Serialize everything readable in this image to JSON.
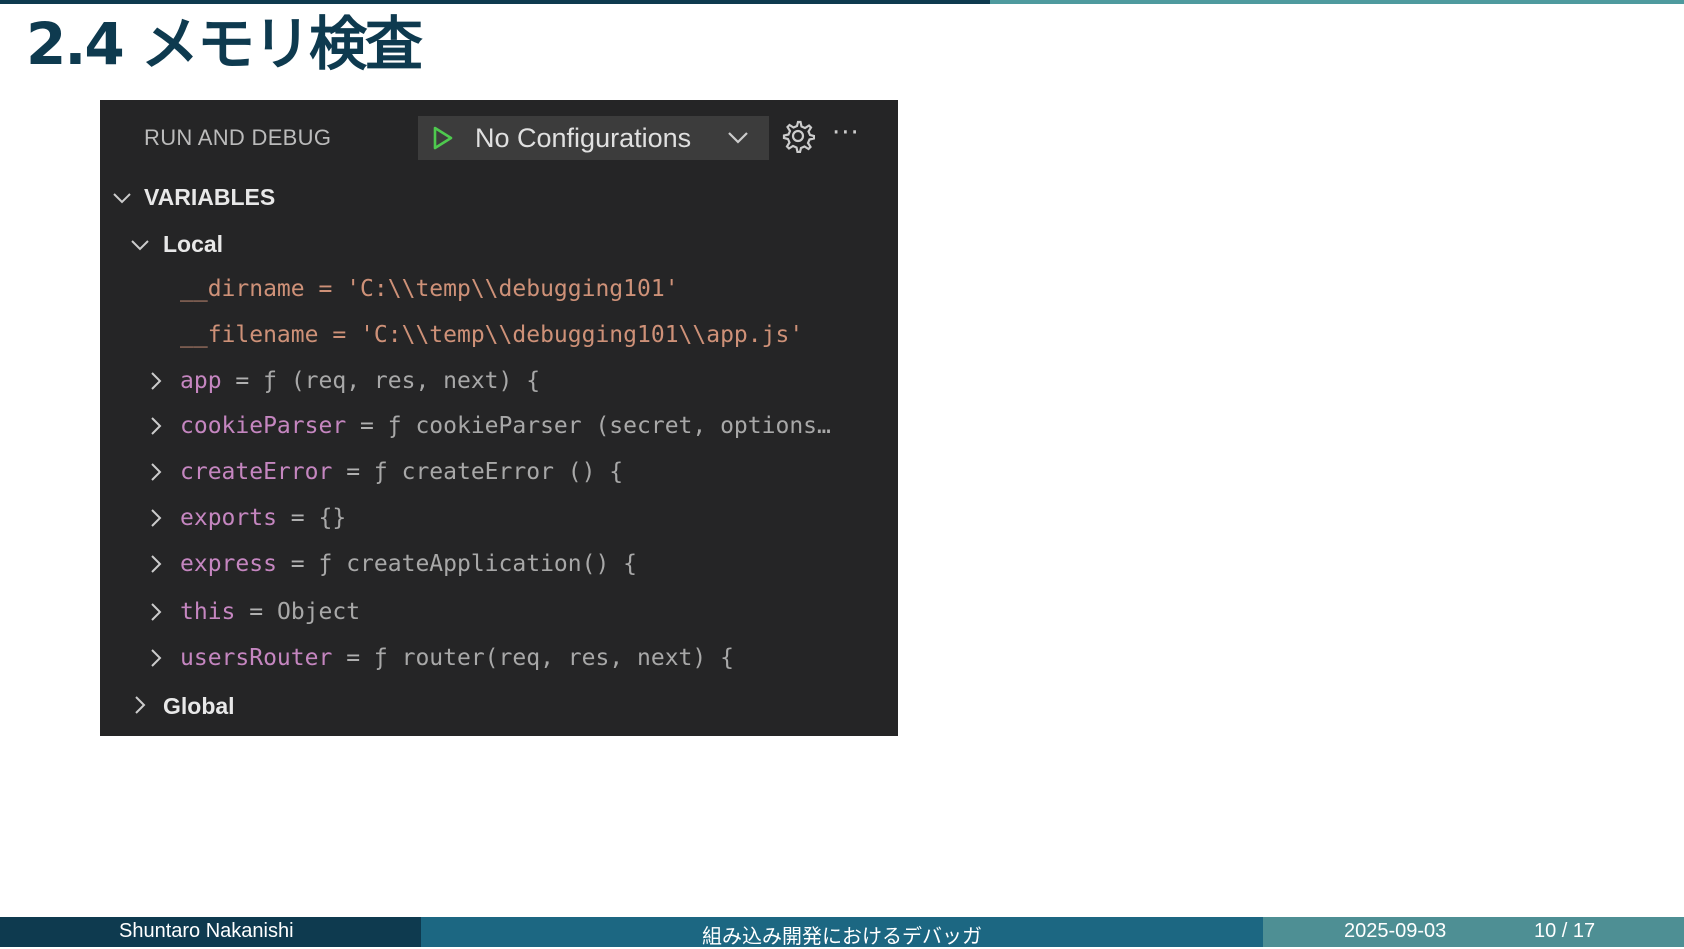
{
  "slide": {
    "title": "2.4 メモリ検査"
  },
  "debug_panel": {
    "header_title": "RUN AND DEBUG",
    "configuration_label": "No Configurations",
    "play_icon": "play-icon",
    "gear_icon": "gear-icon",
    "more_icon": "more-actions-icon",
    "more_glyph": "···"
  },
  "variables": {
    "section_label": "VARIABLES",
    "local_label": "Local",
    "global_label": "Global",
    "items": [
      {
        "name": "__dirname",
        "eq": "=",
        "value": "'C:\\\\temp\\\\debugging101'",
        "kind": "string"
      },
      {
        "name": "__filename",
        "eq": "=",
        "value": "'C:\\\\temp\\\\debugging101\\\\app.js'",
        "kind": "string"
      },
      {
        "name": "app",
        "eq": "=",
        "value": "ƒ (req, res, next) {",
        "kind": "object"
      },
      {
        "name": "cookieParser",
        "eq": "=",
        "value": "ƒ cookieParser (secret, options…",
        "kind": "object"
      },
      {
        "name": "createError",
        "eq": "=",
        "value": "ƒ createError () {",
        "kind": "object"
      },
      {
        "name": "exports",
        "eq": "=",
        "value": "{}",
        "kind": "object"
      },
      {
        "name": "express",
        "eq": "=",
        "value": "ƒ createApplication() {",
        "kind": "object"
      },
      {
        "name": "this",
        "eq": "=",
        "value": "Object",
        "kind": "object"
      },
      {
        "name": "usersRouter",
        "eq": "=",
        "value": "ƒ router(req, res, next) {",
        "kind": "object"
      }
    ]
  },
  "footer": {
    "author": "Shuntaro Nakanishi",
    "talk_title": "組み込み開発におけるデバッガ",
    "date": "2025-09-03",
    "page": "10 / 17"
  },
  "colors": {
    "title": "#0e3a4f",
    "panel_bg": "#252526",
    "variable_name": "#c586c0",
    "string_value": "#ce9178",
    "play": "#4ec94e",
    "footer_dark": "#0e3a4f",
    "footer_mid": "#1c6782",
    "footer_light": "#4e8f94"
  }
}
